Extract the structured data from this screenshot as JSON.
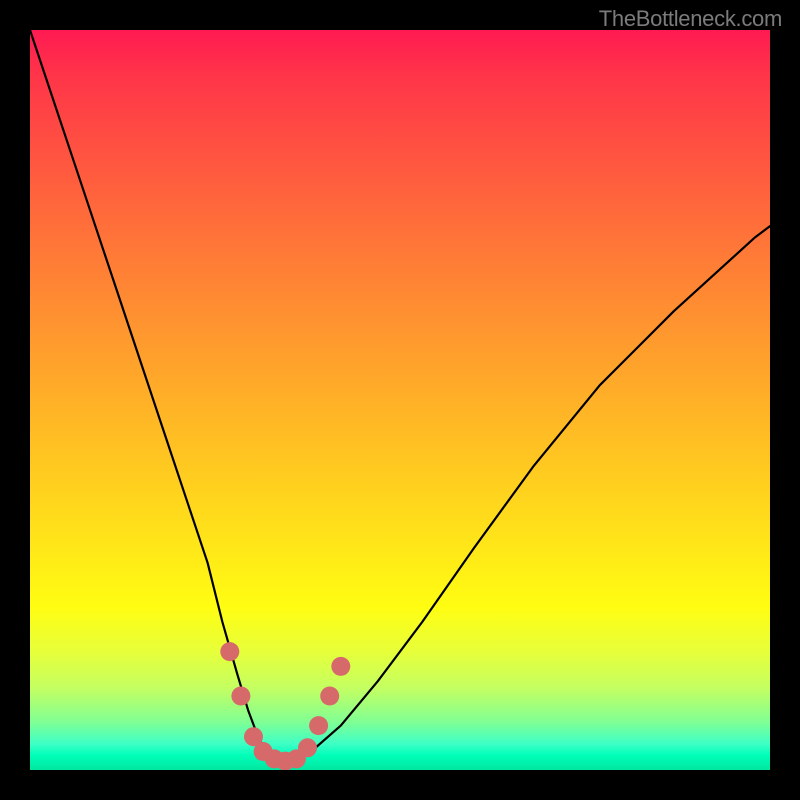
{
  "watermark": "TheBottleneck.com",
  "chart_data": {
    "type": "line",
    "title": "",
    "xlabel": "",
    "ylabel": "",
    "xlim": [
      0,
      100
    ],
    "ylim": [
      0,
      100
    ],
    "series": [
      {
        "name": "bottleneck-curve",
        "x": [
          0,
          3,
          6,
          9,
          12,
          15,
          18,
          21,
          24,
          26,
          28,
          29.5,
          31,
          33,
          35,
          38,
          42,
          47,
          53,
          60,
          68,
          77,
          87,
          98,
          100
        ],
        "y": [
          100,
          91,
          82,
          73,
          64,
          55,
          46,
          37,
          28,
          20,
          13,
          8,
          4,
          1.5,
          1,
          2.5,
          6,
          12,
          20,
          30,
          41,
          52,
          62,
          72,
          73.5
        ]
      }
    ],
    "markers": {
      "name": "highlight-dots",
      "color": "#d66a6a",
      "points": [
        {
          "x": 27.0,
          "y": 16.0
        },
        {
          "x": 28.5,
          "y": 10.0
        },
        {
          "x": 30.2,
          "y": 4.5
        },
        {
          "x": 31.5,
          "y": 2.5
        },
        {
          "x": 33.0,
          "y": 1.5
        },
        {
          "x": 34.5,
          "y": 1.2
        },
        {
          "x": 36.0,
          "y": 1.5
        },
        {
          "x": 37.5,
          "y": 3.0
        },
        {
          "x": 39.0,
          "y": 6.0
        },
        {
          "x": 40.5,
          "y": 10.0
        },
        {
          "x": 42.0,
          "y": 14.0
        }
      ]
    }
  }
}
